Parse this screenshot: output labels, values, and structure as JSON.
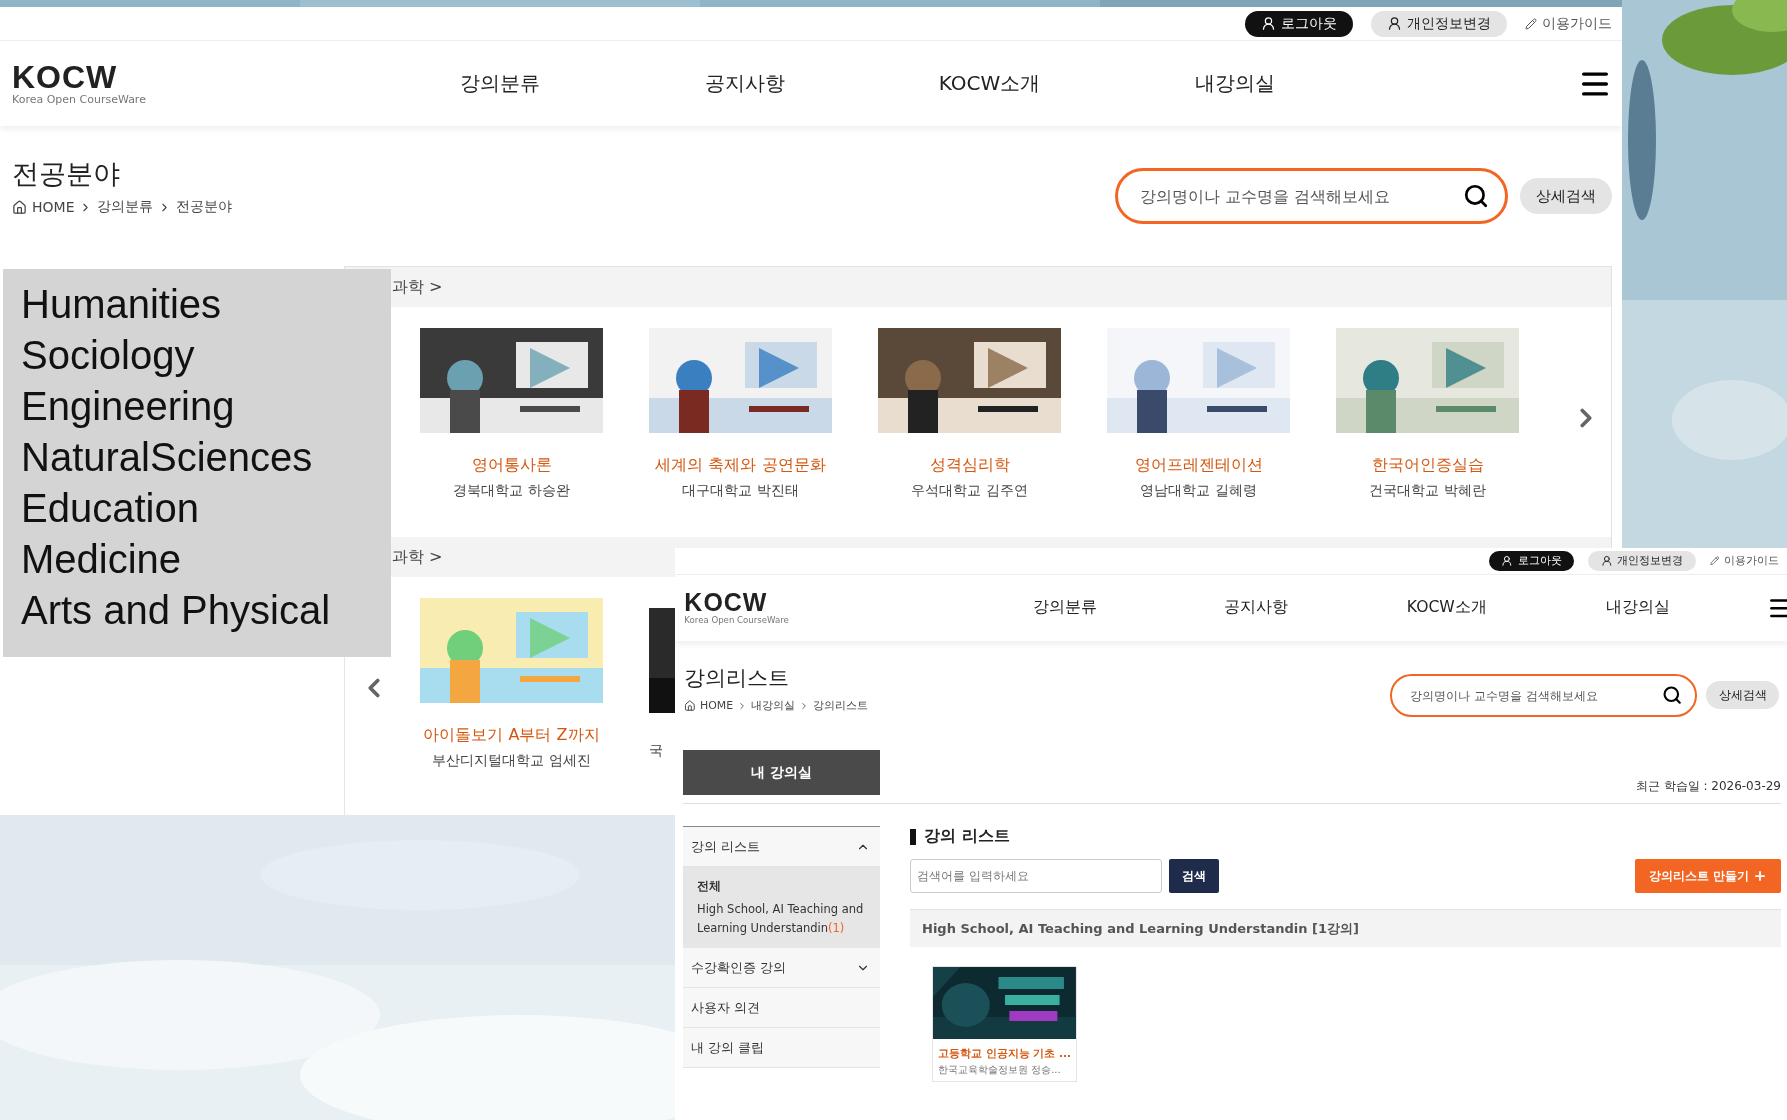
{
  "back_window": {
    "top_links": [
      {
        "label": "로그아웃",
        "kind": "dark"
      },
      {
        "label": "개인정보변경",
        "kind": "light"
      },
      {
        "label": "이용가이드",
        "kind": "link"
      }
    ],
    "logo": {
      "mark": "KOCW",
      "tagline": "Korea Open CourseWare"
    },
    "nav": [
      "강의분류",
      "공지사항",
      "KOCW소개",
      "내강의실"
    ],
    "page_title": "전공분야",
    "breadcrumb": [
      "HOME",
      "강의분류",
      "전공분야"
    ],
    "search": {
      "placeholder": "강의명이나 교수명을 검색해보세요"
    },
    "detail_search": "상세검색",
    "sections": [
      {
        "heading": "과학 >",
        "kind": "next",
        "courses": [
          {
            "title": "영어통사론",
            "instructor": "경북대학교 하승완"
          },
          {
            "title": "세계의 축제와 공연문화",
            "instructor": "대구대학교 박진태"
          },
          {
            "title": "성격심리학",
            "instructor": "우석대학교 김주연"
          },
          {
            "title": "영어프레젠테이션",
            "instructor": "영남대학교 길혜령"
          },
          {
            "title": "한국어인증실습",
            "instructor": "건국대학교 박혜란"
          }
        ]
      },
      {
        "heading": "과학 >",
        "kind": "prev",
        "courses": [
          {
            "title": "아이돌보기 A부터 Z까지",
            "instructor": "부산디지털대학교 엄세진"
          },
          {
            "instructor": "국"
          }
        ]
      }
    ]
  },
  "overlay_list": [
    "Humanities",
    "Sociology",
    "Engineering",
    "NaturalSciences",
    "Education",
    "Medicine",
    "Arts and Physical"
  ],
  "front_window": {
    "top_links": [
      {
        "label": "로그아웃",
        "kind": "dark"
      },
      {
        "label": "개인정보변경",
        "kind": "light"
      },
      {
        "label": "이용가이드",
        "kind": "link"
      }
    ],
    "logo": {
      "mark": "KOCW",
      "tagline": "Korea Open CourseWare"
    },
    "nav": [
      "강의분류",
      "공지사항",
      "KOCW소개",
      "내강의실"
    ],
    "page_title": "강의리스트",
    "breadcrumb": [
      "HOME",
      "내강의실",
      "강의리스트"
    ],
    "search": {
      "placeholder": "강의명이나 교수명을 검색해보세요"
    },
    "detail_search": "상세검색",
    "my_room_button": "내 강의실",
    "last_study": "최근 학습일 : 2026-03-29",
    "sidebar": [
      {
        "label": "강의 리스트",
        "kind": "accordion",
        "expanded": true,
        "panel": {
          "heading": "전체",
          "entry": "High School, AI Teaching and Learning Understandin",
          "count": "(1)"
        }
      },
      {
        "label": "수강확인증 강의",
        "kind": "accordion",
        "expanded": false
      },
      {
        "label": "사용자 의견",
        "kind": "link"
      },
      {
        "label": "내 강의 클립",
        "kind": "link"
      }
    ],
    "list_heading": "강의 리스트",
    "list_search": {
      "placeholder": "검색어를 입력하세요"
    },
    "search_button": "검색",
    "create_button": "강의리스트 만들기",
    "group": {
      "title": "High School, AI Teaching and Learning Understandin [1강의]",
      "card": {
        "title": "고등학교 인공지능 기초 ...",
        "subtitle": "한국교육학술정보원 정승..."
      }
    }
  }
}
